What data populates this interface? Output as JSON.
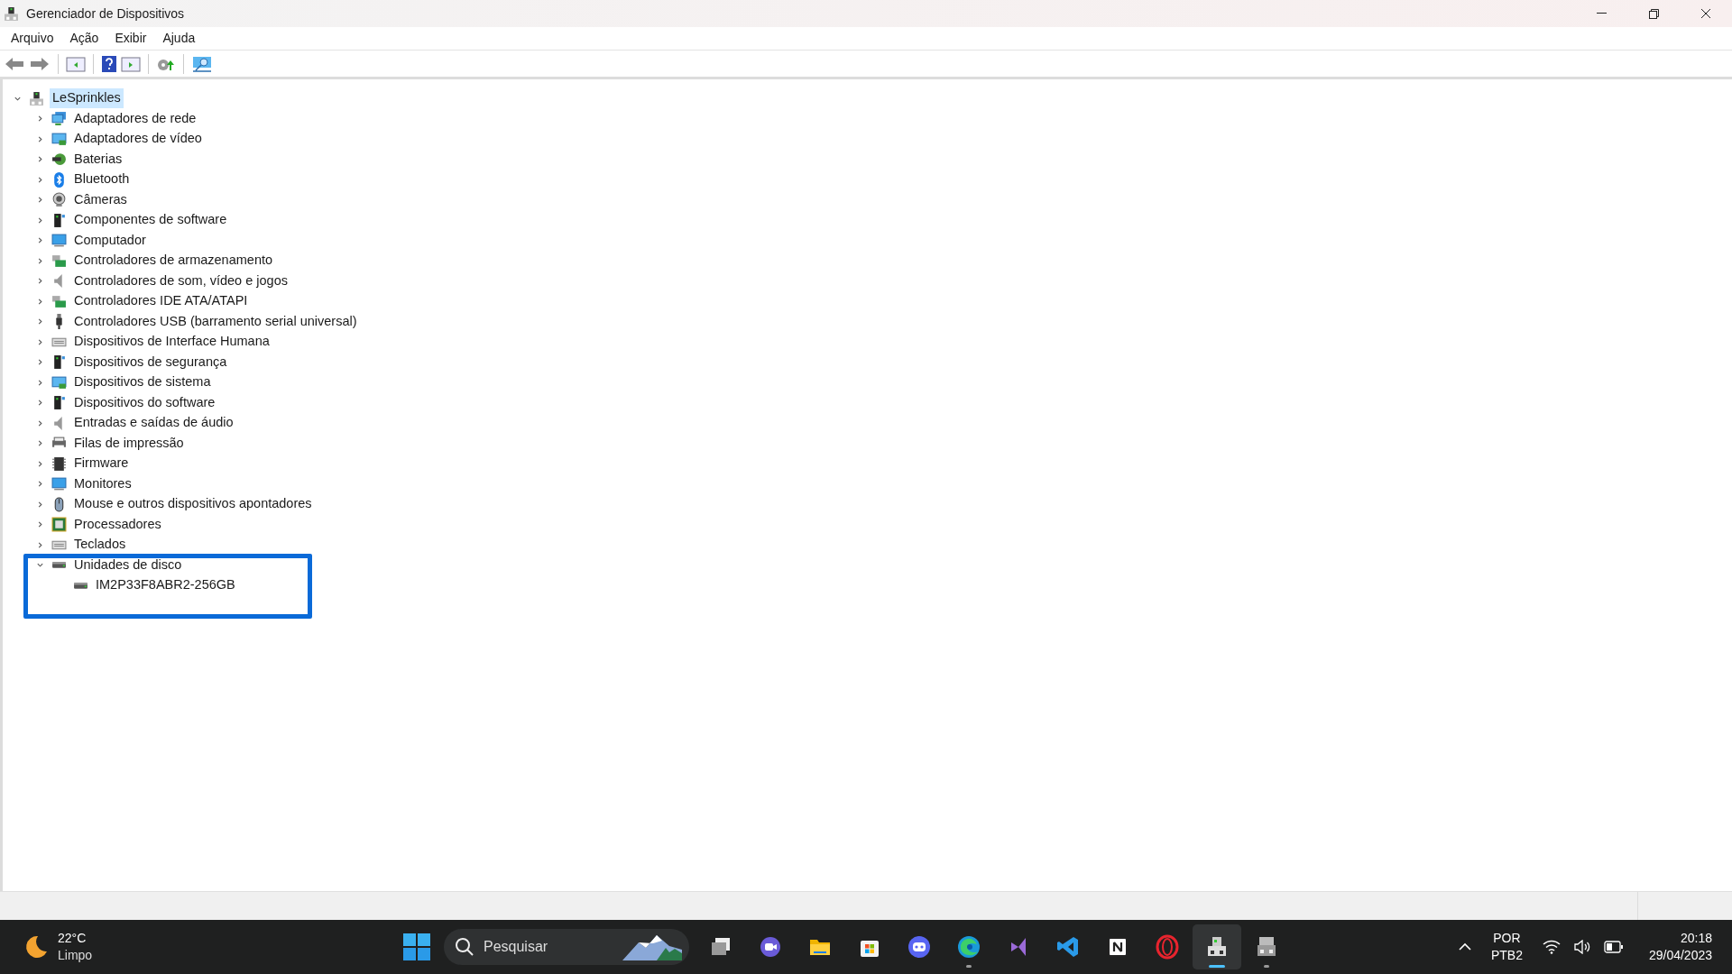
{
  "window": {
    "title": "Gerenciador de Dispositivos"
  },
  "menu": [
    "Arquivo",
    "Ação",
    "Exibir",
    "Ajuda"
  ],
  "tree": {
    "label": "LeSprinkles",
    "expanded": true,
    "selected": true,
    "children": [
      {
        "label": "Adaptadores de rede",
        "expanded": false
      },
      {
        "label": "Adaptadores de vídeo",
        "expanded": false
      },
      {
        "label": "Baterias",
        "expanded": false
      },
      {
        "label": "Bluetooth",
        "expanded": false
      },
      {
        "label": "Câmeras",
        "expanded": false
      },
      {
        "label": "Componentes de software",
        "expanded": false
      },
      {
        "label": "Computador",
        "expanded": false
      },
      {
        "label": "Controladores de armazenamento",
        "expanded": false
      },
      {
        "label": "Controladores de som, vídeo e jogos",
        "expanded": false
      },
      {
        "label": "Controladores IDE ATA/ATAPI",
        "expanded": false
      },
      {
        "label": "Controladores USB (barramento serial universal)",
        "expanded": false
      },
      {
        "label": "Dispositivos de Interface Humana",
        "expanded": false
      },
      {
        "label": "Dispositivos de segurança",
        "expanded": false
      },
      {
        "label": "Dispositivos de sistema",
        "expanded": false
      },
      {
        "label": "Dispositivos do software",
        "expanded": false
      },
      {
        "label": "Entradas e saídas de áudio",
        "expanded": false
      },
      {
        "label": "Filas de impressão",
        "expanded": false
      },
      {
        "label": "Firmware",
        "expanded": false
      },
      {
        "label": "Monitores",
        "expanded": false
      },
      {
        "label": "Mouse e outros dispositivos apontadores",
        "expanded": false
      },
      {
        "label": "Processadores",
        "expanded": false
      },
      {
        "label": "Teclados",
        "expanded": false
      },
      {
        "label": "Unidades de disco",
        "expanded": true,
        "children": [
          {
            "label": "IM2P33F8ABR2-256GB"
          }
        ]
      }
    ]
  },
  "taskbar": {
    "weather": {
      "temperature": "22°C",
      "condition": "Limpo"
    },
    "search": {
      "placeholder": "Pesquisar"
    },
    "apps": [
      {
        "kind": "taskview",
        "running": false,
        "active": false
      },
      {
        "kind": "chat",
        "running": false,
        "active": false
      },
      {
        "kind": "folder",
        "running": false,
        "active": false
      },
      {
        "kind": "store",
        "running": false,
        "active": false
      },
      {
        "kind": "discord",
        "running": false,
        "active": false
      },
      {
        "kind": "edge",
        "running": true,
        "active": false
      },
      {
        "kind": "vs",
        "running": false,
        "active": false
      },
      {
        "kind": "vscode",
        "running": false,
        "active": false
      },
      {
        "kind": "notion",
        "running": false,
        "active": false
      },
      {
        "kind": "opera",
        "running": false,
        "active": false
      },
      {
        "kind": "devmgr",
        "running": true,
        "active": true
      },
      {
        "kind": "devmgr2",
        "running": true,
        "active": false
      }
    ],
    "language": [
      "POR",
      "PTB2"
    ],
    "time": "20:18",
    "date": "29/04/2023"
  }
}
